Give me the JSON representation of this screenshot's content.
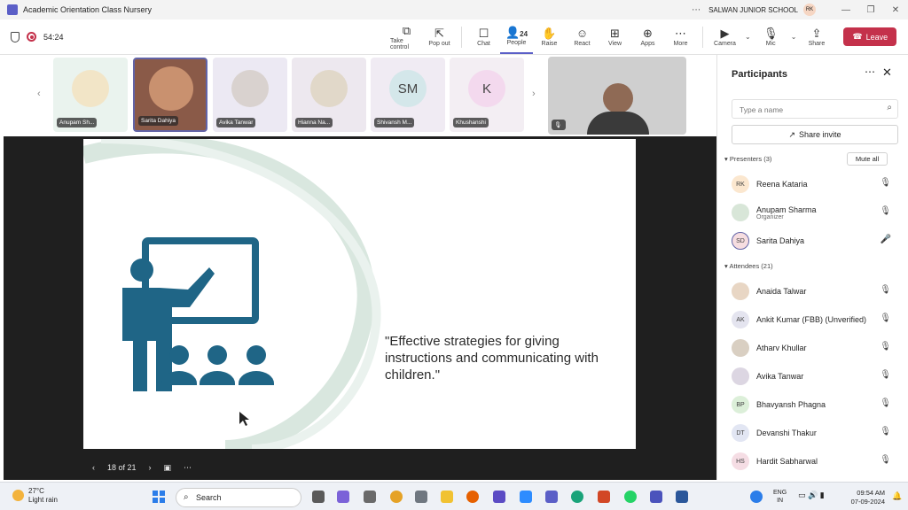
{
  "window": {
    "title": "Academic Orientation Class Nursery",
    "org": "SALWAN JUNIOR SCHOOL",
    "user_initials": "RK"
  },
  "meeting": {
    "timer": "54:24"
  },
  "toolbar": {
    "take_control": "Take control",
    "pop_out": "Pop out",
    "chat": "Chat",
    "people": "People",
    "people_count": "24",
    "raise": "Raise",
    "react": "React",
    "view": "View",
    "apps": "Apps",
    "more": "More",
    "camera": "Camera",
    "mic": "Mic",
    "share": "Share",
    "leave": "Leave"
  },
  "tiles": [
    {
      "name": "Anupam Sh..."
    },
    {
      "name": "Sarita Dahiya"
    },
    {
      "name": "Avika Tanwar"
    },
    {
      "name": "Hianna Na..."
    },
    {
      "name": "Shivansh M...",
      "initials": "SM"
    },
    {
      "name": "Khushanshi",
      "initials": "K"
    }
  ],
  "slide": {
    "quote": "\"Effective strategies for giving instructions and communicating with children.\"",
    "counter": "18 of 21"
  },
  "panel": {
    "title": "Participants",
    "search_placeholder": "Type a name",
    "share_invite": "Share invite",
    "presenters_label": "Presenters (3)",
    "mute_all": "Mute all",
    "attendees_label": "Attendees (21)",
    "presenters": [
      {
        "initials": "RK",
        "name": "Reena Kataria"
      },
      {
        "initials": "",
        "name": "Anupam Sharma",
        "role": "Organizer"
      },
      {
        "initials": "SD",
        "name": "Sarita Dahiya"
      }
    ],
    "attendees": [
      {
        "initials": "",
        "name": "Anaida Talwar"
      },
      {
        "initials": "AK",
        "name": "Ankit Kumar (FBB) (Unverified)"
      },
      {
        "initials": "",
        "name": "Atharv Khullar"
      },
      {
        "initials": "",
        "name": "Avika Tanwar"
      },
      {
        "initials": "BP",
        "name": "Bhavyansh Phagna"
      },
      {
        "initials": "DT",
        "name": "Devanshi Thakur"
      },
      {
        "initials": "HS",
        "name": "Hardit Sabharwal"
      }
    ]
  },
  "taskbar": {
    "temp": "27°C",
    "weather": "Light rain",
    "search": "Search",
    "lang1": "ENG",
    "lang2": "IN",
    "time": "09:54 AM",
    "date": "07-09-2024"
  }
}
